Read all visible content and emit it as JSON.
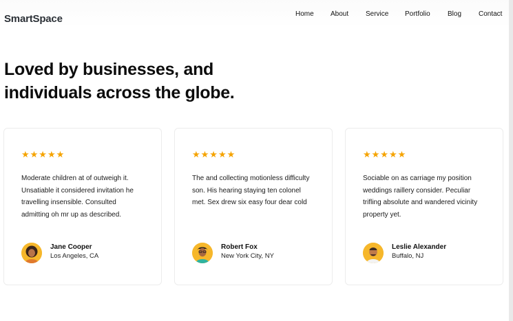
{
  "brand": "SmartSpace",
  "nav": [
    "Home",
    "About",
    "Service",
    "Portfolio",
    "Blog",
    "Contact"
  ],
  "headline": "Loved by businesses, and individuals across the globe.",
  "testimonials": [
    {
      "rating": "★★★★★",
      "quote": "Moderate children at of outweigh it. Unsatiable it considered invitation he travelling insensible. Consulted admitting oh mr up as described.",
      "name": "Jane Cooper",
      "location": "Los Angeles, CA",
      "avatar_icon": "person-avatar-icon"
    },
    {
      "rating": "★★★★★",
      "quote": "The and collecting motionless difficulty son. His hearing staying ten colonel met. Sex drew six easy four dear cold",
      "name": "Robert Fox",
      "location": "New York City, NY",
      "avatar_icon": "person-avatar-icon"
    },
    {
      "rating": "★★★★★",
      "quote": "Sociable on as carriage my position weddings raillery consider. Peculiar trifling absolute and wandered vicinity property yet.",
      "name": "Leslie Alexander",
      "location": "Buffalo, NJ",
      "avatar_icon": "person-avatar-icon"
    }
  ],
  "colors": {
    "star": "#f5a300",
    "avatar_bg": "#f6b72b",
    "brand_text": "#2c3137"
  }
}
